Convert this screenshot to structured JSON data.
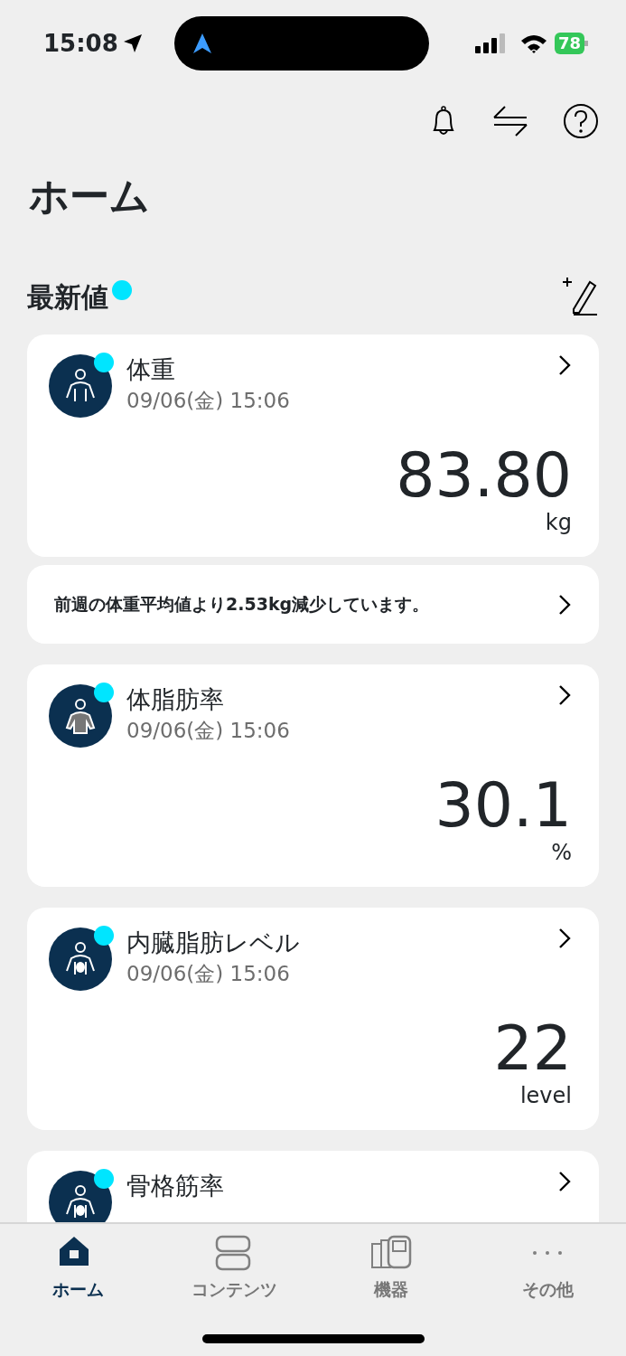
{
  "status_bar": {
    "time": "15:08",
    "battery": "78"
  },
  "title": "ホーム",
  "section": {
    "title": "最新値",
    "new": true
  },
  "cards": [
    {
      "kind": "measurement",
      "name": "体重",
      "date": "09/06(金) 15:06",
      "value": "83.80",
      "unit": "kg",
      "new": true
    },
    {
      "kind": "notice",
      "text": "前週の体重平均値より2.53kg減少しています。"
    },
    {
      "kind": "measurement",
      "name": "体脂肪率",
      "date": "09/06(金) 15:06",
      "value": "30.1",
      "unit": "%",
      "new": true
    },
    {
      "kind": "measurement",
      "name": "内臓脂肪レベル",
      "date": "09/06(金) 15:06",
      "value": "22",
      "unit": "level",
      "new": true
    },
    {
      "kind": "measurement",
      "name": "骨格筋率",
      "new": true
    }
  ],
  "tabs": [
    {
      "label": "ホーム",
      "selected": true
    },
    {
      "label": "コンテンツ",
      "selected": false
    },
    {
      "label": "機器",
      "selected": false
    },
    {
      "label": "その他",
      "selected": false
    }
  ]
}
